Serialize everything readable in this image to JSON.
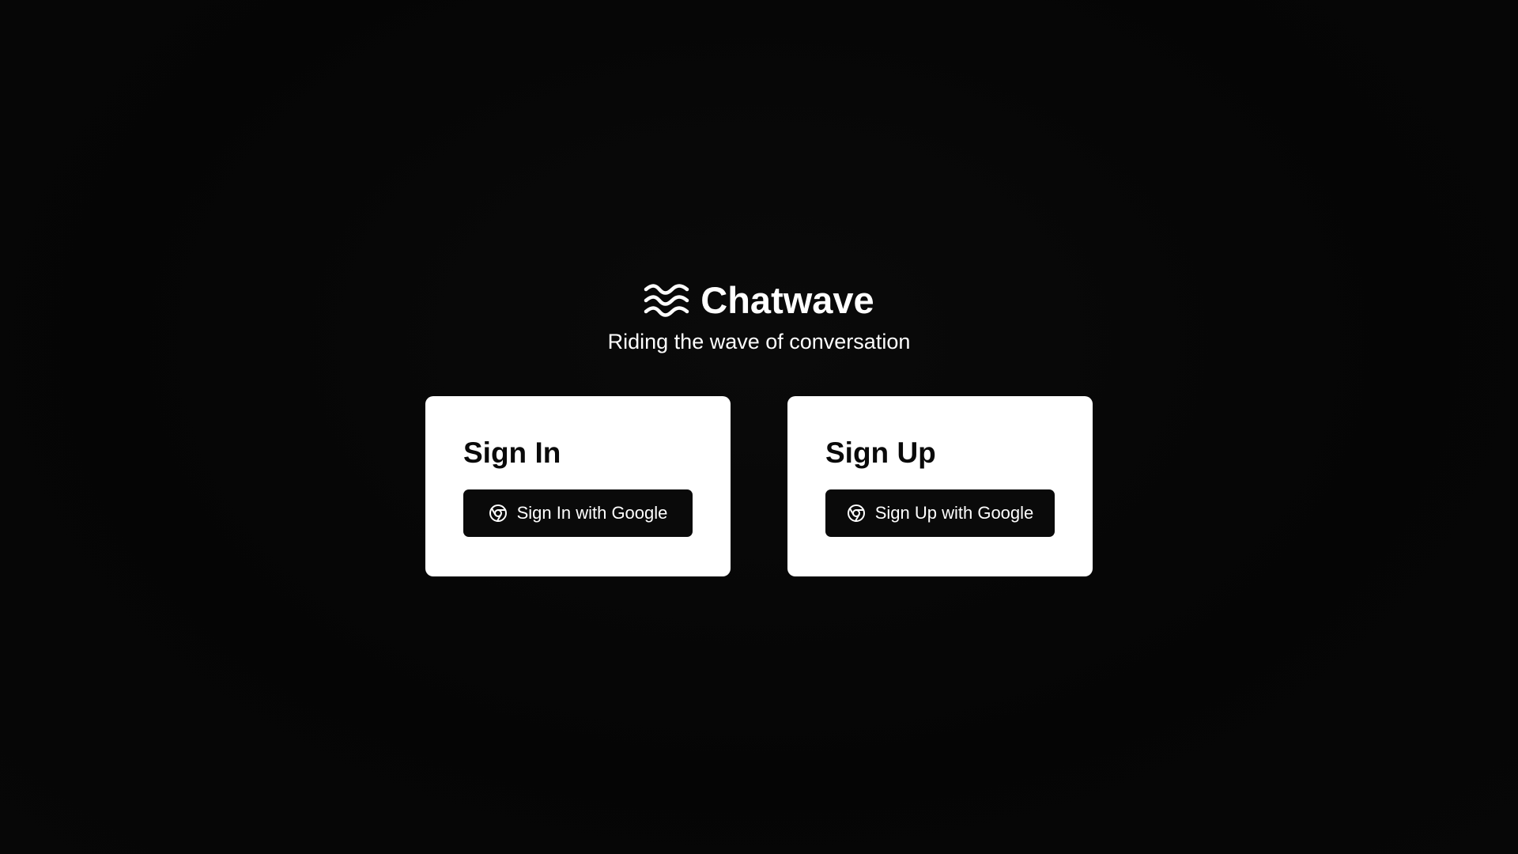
{
  "brand": {
    "name": "Chatwave",
    "tagline": "Riding the wave of conversation",
    "logo_icon": "waves-icon"
  },
  "sign_in": {
    "title": "Sign In",
    "button_label": "Sign In with Google",
    "button_icon": "chrome-icon"
  },
  "sign_up": {
    "title": "Sign Up",
    "button_label": "Sign Up with Google",
    "button_icon": "chrome-icon"
  },
  "colors": {
    "background": "#050505",
    "card": "#ffffff",
    "button": "#0a0a0a",
    "text_light": "#ffffff",
    "text_dark": "#0a0a0a"
  }
}
